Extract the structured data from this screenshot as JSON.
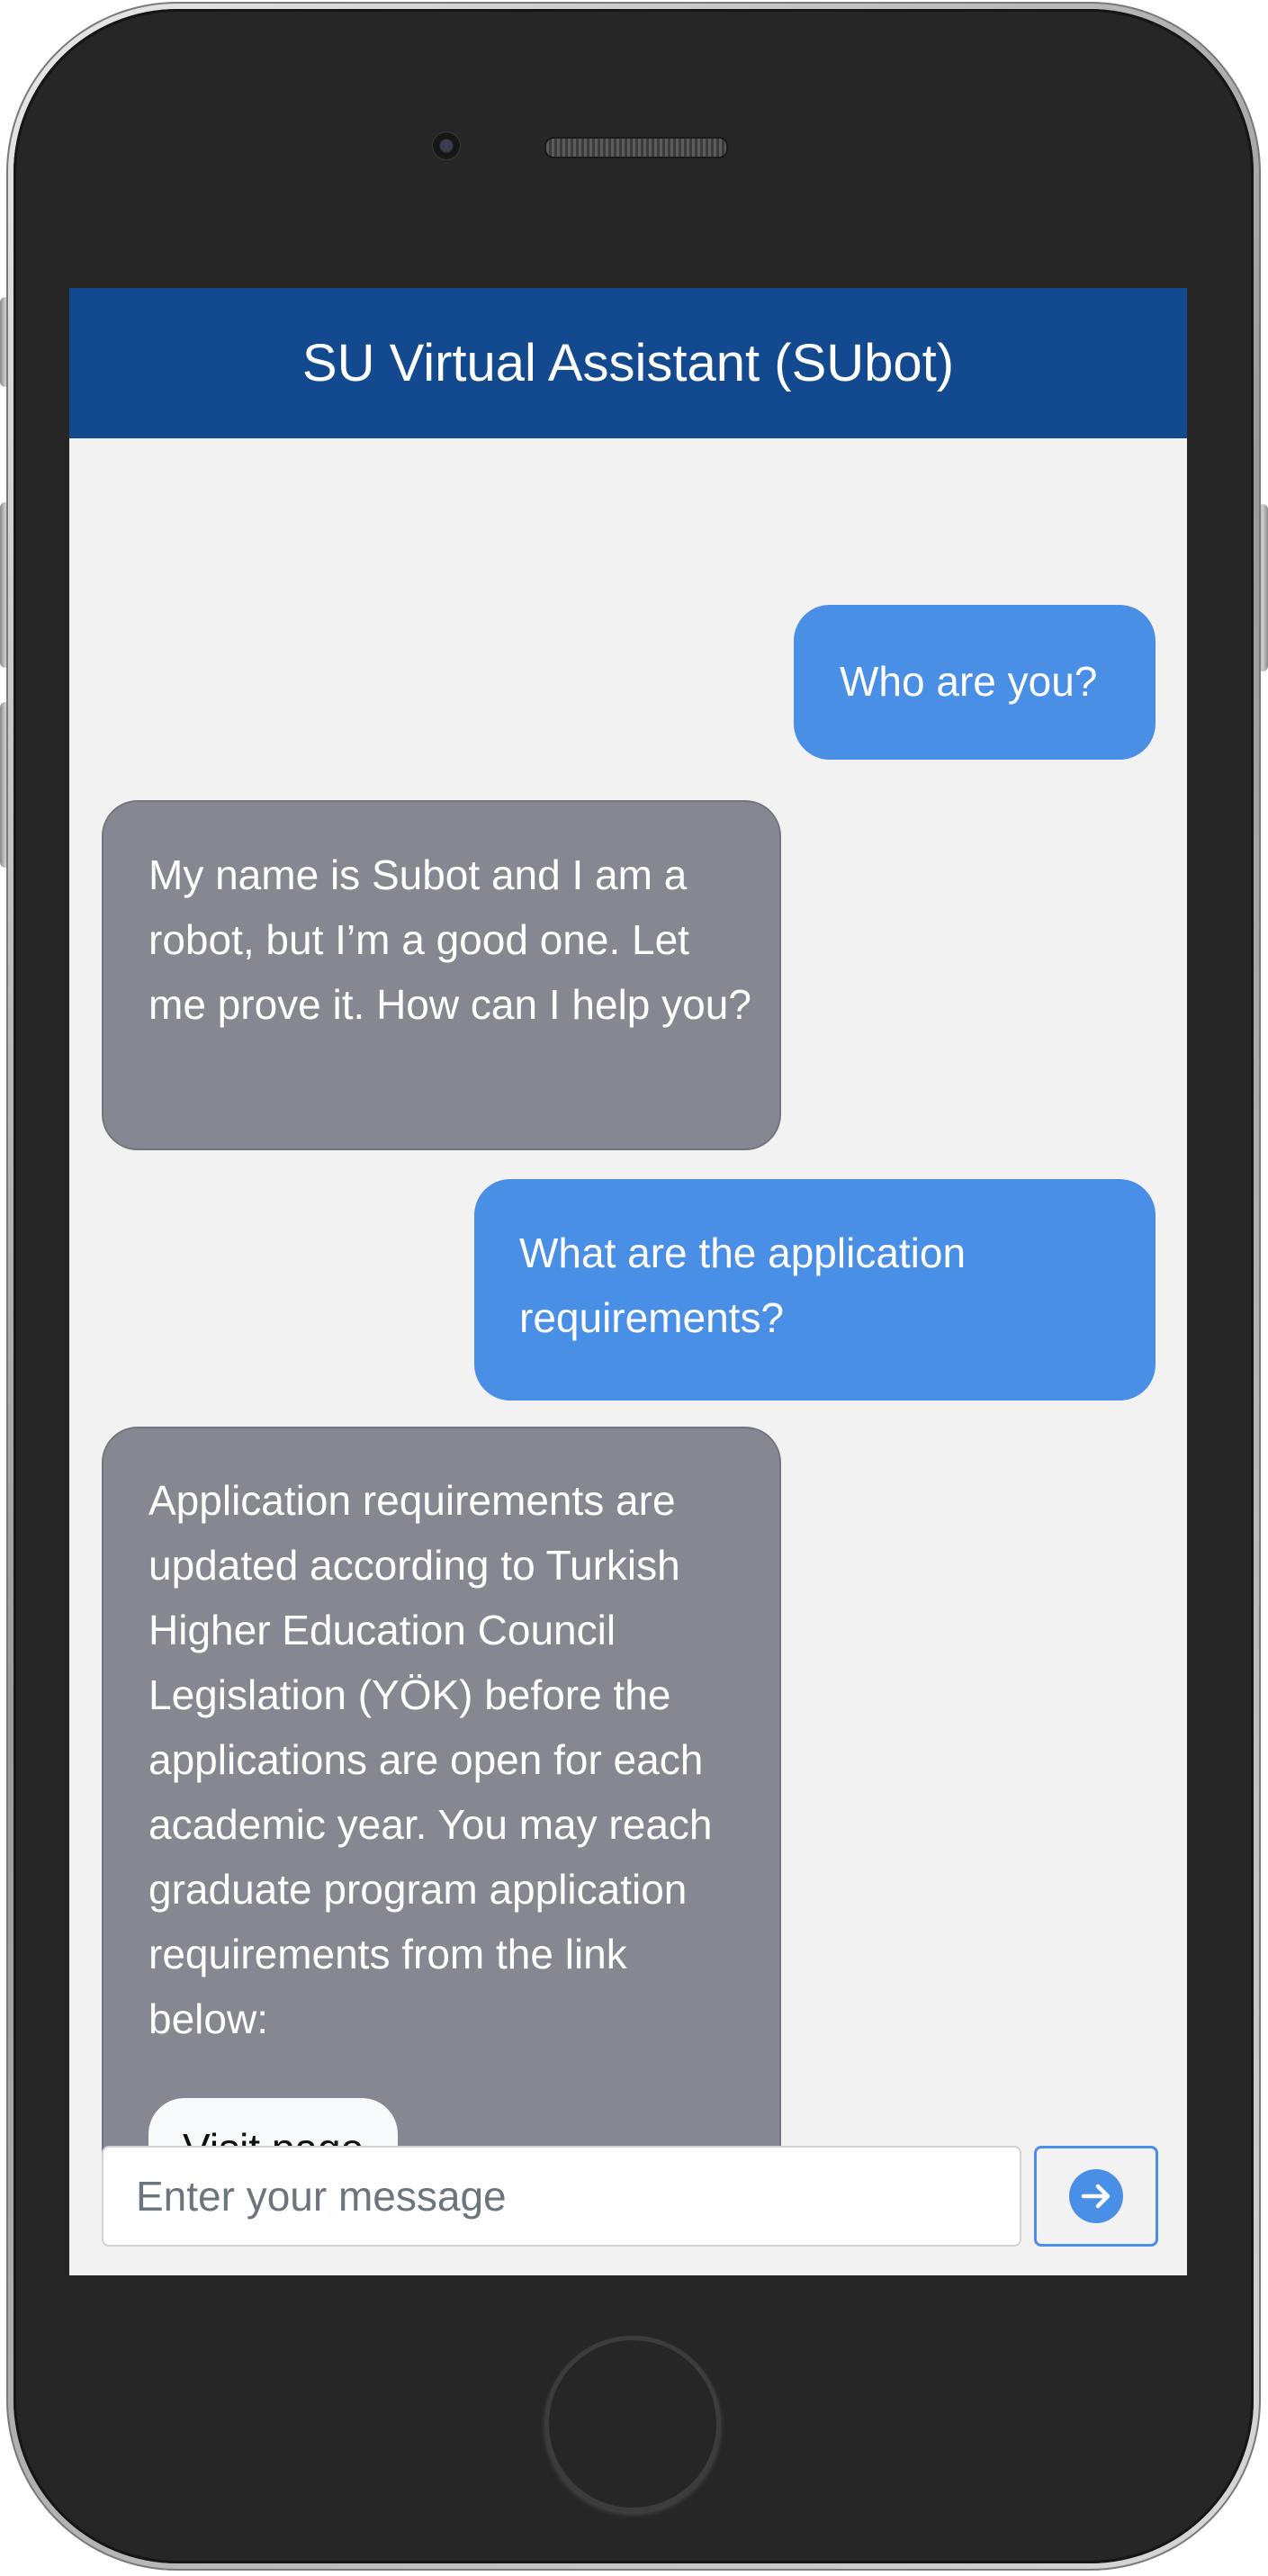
{
  "header": {
    "title": "SU Virtual Assistant (SUbot)"
  },
  "messages": [
    {
      "sender": "user",
      "text": "Who are you?"
    },
    {
      "sender": "bot",
      "text": "My name is Subot and I am a robot, but I’m a good one. Let me prove it. How can I help you?"
    },
    {
      "sender": "user",
      "text": "What are the application requirements?"
    },
    {
      "sender": "bot",
      "text": "Application requirements are updated according to Turkish Higher Education Council Legislation (YÖK) before the applications are open for each academic year. You may reach graduate program application requirements from the link below:",
      "button_label": "Visit page"
    }
  ],
  "composer": {
    "placeholder": "Enter your message",
    "value": ""
  },
  "colors": {
    "header_bg": "#134a8f",
    "user_bubble": "#4a8fe6",
    "bot_bubble": "#878792",
    "screen_bg": "#f2f2f3"
  },
  "icons": {
    "send": "arrow-right-circle-icon"
  }
}
